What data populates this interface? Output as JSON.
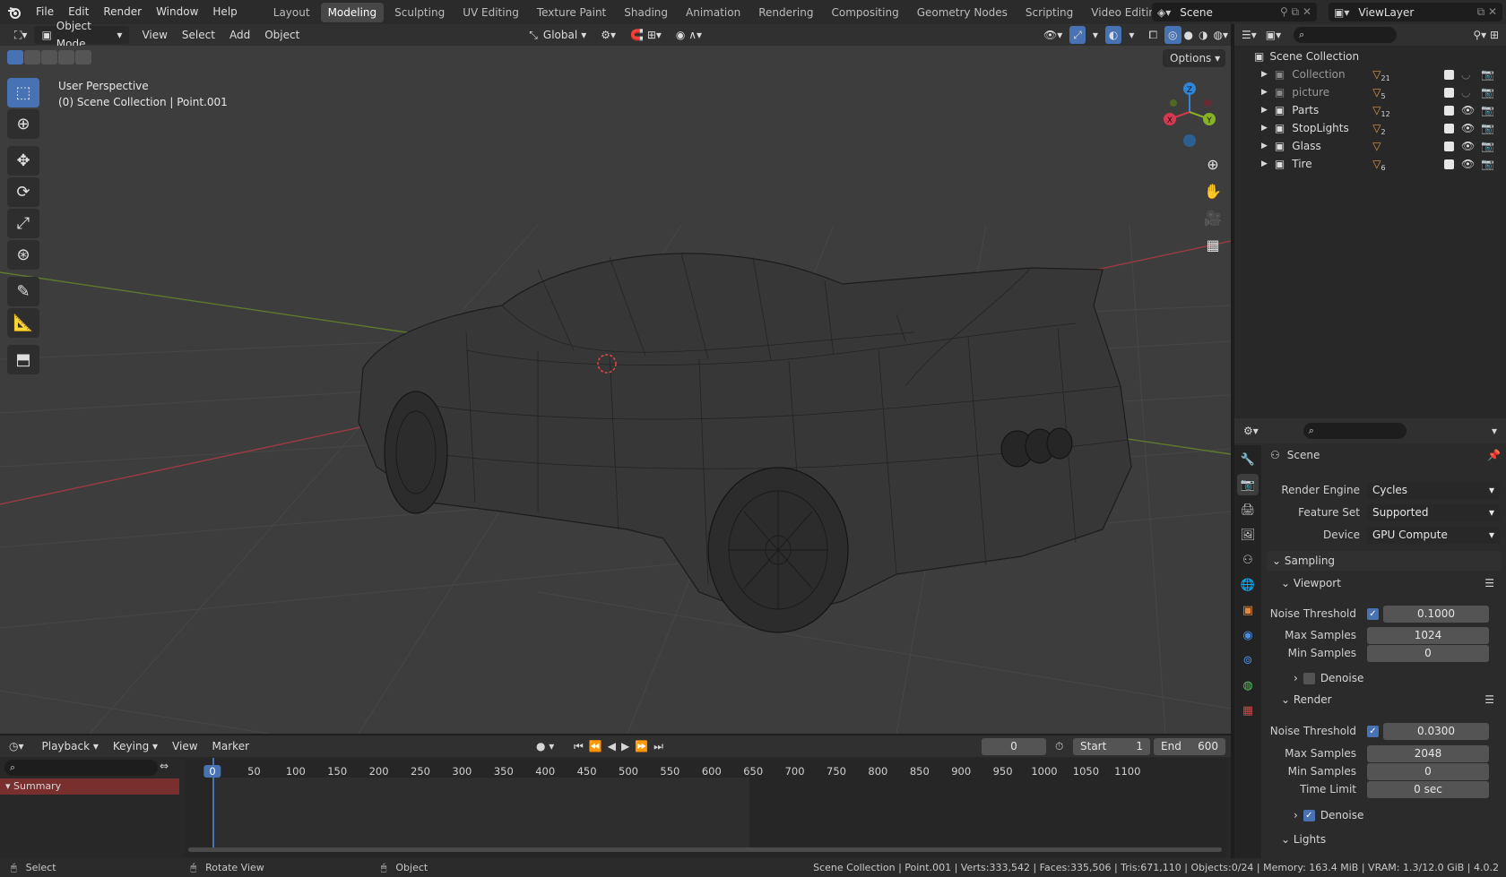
{
  "topbar": {
    "menus": [
      "File",
      "Edit",
      "Render",
      "Window",
      "Help"
    ],
    "workspaces": [
      "Layout",
      "Modeling",
      "Sculpting",
      "UV Editing",
      "Texture Paint",
      "Shading",
      "Animation",
      "Rendering",
      "Compositing",
      "Geometry Nodes",
      "Scripting",
      "Video Editing"
    ],
    "active_workspace": "Modeling",
    "add_tab": "+",
    "scene": "Scene",
    "view_layer": "ViewLayer"
  },
  "viewport_header": {
    "mode": "Object Mode",
    "menus": [
      "View",
      "Select",
      "Add",
      "Object"
    ],
    "orientation": "Global",
    "options": "Options"
  },
  "viewport": {
    "perspective": "User Perspective",
    "collection_info": "(0) Scene Collection | Point.001",
    "gizmo_axes": {
      "x": "X",
      "y": "Y",
      "z": "Z"
    },
    "colors": {
      "x": "#d6394f",
      "y": "#86b326",
      "z": "#2f86d6",
      "grid": "#4a4a4a",
      "bg": "#3d3d3d"
    }
  },
  "outliner": {
    "root": "Scene Collection",
    "items": [
      {
        "name": "Collection",
        "badge": "21",
        "dim": true
      },
      {
        "name": "picture",
        "badge": "5",
        "dim": true
      },
      {
        "name": "Parts",
        "badge": "12",
        "dim": false
      },
      {
        "name": "StopLights",
        "badge": "2",
        "dim": false
      },
      {
        "name": "Glass",
        "badge": "",
        "dim": false
      },
      {
        "name": "Tire",
        "badge": "6",
        "dim": false
      }
    ]
  },
  "properties": {
    "context": "Scene",
    "render_engine_label": "Render Engine",
    "render_engine": "Cycles",
    "feature_set_label": "Feature Set",
    "feature_set": "Supported",
    "device_label": "Device",
    "device": "GPU Compute",
    "sampling": "Sampling",
    "viewport_panel": "Viewport",
    "render_panel": "Render",
    "noise_threshold_label": "Noise Threshold",
    "max_samples_label": "Max Samples",
    "min_samples_label": "Min Samples",
    "denoise_label": "Denoise",
    "time_limit_label": "Time Limit",
    "viewport_noise": "0.1000",
    "viewport_max": "1024",
    "viewport_min": "0",
    "render_noise": "0.0300",
    "render_max": "2048",
    "render_min": "0",
    "render_time_limit": "0 sec",
    "lights": "Lights"
  },
  "timeline": {
    "menus": [
      "Playback",
      "Keying",
      "View",
      "Marker"
    ],
    "current_frame": "0",
    "start_label": "Start",
    "start": "1",
    "end_label": "End",
    "end": "600",
    "ticks": [
      "0",
      "50",
      "100",
      "150",
      "200",
      "250",
      "300",
      "350",
      "400",
      "450",
      "500",
      "550",
      "600",
      "650",
      "700",
      "750",
      "800",
      "850",
      "900",
      "950",
      "1000",
      "1050",
      "1100"
    ],
    "summary": "Summary"
  },
  "statusbar": {
    "select": "Select",
    "rotate": "Rotate View",
    "object": "Object",
    "stats": "Scene Collection | Point.001 | Verts:333,542 | Faces:335,506 | Tris:671,110 | Objects:0/24 | Memory: 163.4 MiB | VRAM: 1.3/12.0 GiB | 4.0.2"
  }
}
